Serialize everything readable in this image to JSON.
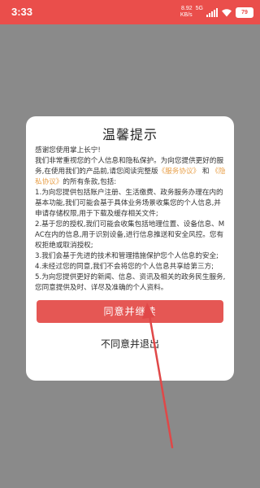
{
  "status_bar": {
    "time": "3:33",
    "net_speed_value": "8.92",
    "net_speed_unit": "KB/s",
    "network_type": "5G",
    "battery": "79",
    "accent_color": "#ea4e4b"
  },
  "dialog": {
    "title": "温馨提示",
    "greeting": "感谢您使用掌上长宁!",
    "intro_before": "我们非常重视您的个人信息和隐私保护。为向您提供更好的服务,在使用我们的产品前,请您阅读完整版",
    "service_agreement_link": "《服务协议》",
    "intro_and": "和",
    "privacy_agreement_link": "《隐私协议》",
    "intro_after": "的所有条款,包括:",
    "clauses": [
      "1.为向您提供包括账户注册、生活缴费、政务服务办理在内的基本功能,我们可能会基于具体业务场景收集您的个人信息,并申请存储权限,用于下载及缓存相关文件;",
      "2.基于您的授权,我们可能会收集包括地理位置、设备信息、MAC在内的信息,用于识别设备,进行信息推送和安全风控。您有权拒绝或取消授权;",
      "3.我们会基于先进的技术和管理措施保护您个人信息的安全;",
      "4.未经过您的同意,我们不会将您的个人信息共享给第三方;",
      "5.为向您提供更好的新闻、信息、资讯及相关的政务民生服务,您同意提供及时、详尽及准确的个人资料。"
    ],
    "agree_label": "同意并继续",
    "disagree_label": "不同意并退出",
    "link_color": "#e8a04a",
    "button_color": "#e55754"
  }
}
